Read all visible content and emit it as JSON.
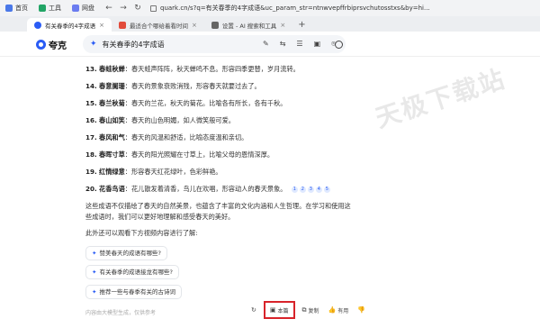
{
  "browser": {
    "apps": [
      {
        "label": "首页",
        "color": "#4a78e8"
      },
      {
        "label": "工具",
        "color": "#22a566"
      },
      {
        "label": "网盘",
        "color": "#6b7cf0"
      }
    ],
    "address": "quark.cn/s?q=有关春季的4字成语&uc_param_str=ntnwvepffrbiprsvchutosstxs&by=hi..."
  },
  "tabs": [
    {
      "label": "有关春季的4字成语",
      "close": "×"
    },
    {
      "label": "最适合个哪给着看时间",
      "close": "×"
    },
    {
      "label": "设置 - AI 搜索和工具",
      "close": "×"
    }
  ],
  "new_tab": "+",
  "header": {
    "logo": "夸克",
    "query": "有关春季的4字成语"
  },
  "watermark": "天极下载站",
  "items": [
    {
      "num": "13.",
      "term": "春蛙秋蝉",
      "text": "：春天蛙声阵阵，秋天蝉鸣不息。形容四季更替，岁月流转。"
    },
    {
      "num": "14.",
      "term": "春意阑珊",
      "text": "：春天的景象衰败消残，形容春天就要过去了。"
    },
    {
      "num": "15.",
      "term": "春兰秋菊",
      "text": "：春天的兰花，秋天的菊花。比喻各有所长，各有千秋。"
    },
    {
      "num": "16.",
      "term": "春山如笑",
      "text": "：春天的山色明媚，如人微笑般可爱。"
    },
    {
      "num": "17.",
      "term": "春风和气",
      "text": "：春天的风温和舒适，比喻态度温和亲切。"
    },
    {
      "num": "18.",
      "term": "春晖寸草",
      "text": "：春天的阳光照耀在寸草上，比喻父母的恩情深厚。"
    },
    {
      "num": "19.",
      "term": "红情绿意",
      "text": "：形容春天红花绿叶，色彩鲜艳。"
    },
    {
      "num": "20.",
      "term": "花香鸟语",
      "text": "：花儿散发着清香，鸟儿在欢唱，形容动人的春天景象。"
    }
  ],
  "refs": [
    "1",
    "2",
    "3",
    "4",
    "5"
  ],
  "summary_line1": "这些成语不仅描绘了春天的自然美景，也蕴含了丰富的文化内涵和人生哲理。在学习和使用这",
  "summary_line2": "些成语时，我们可以更好地理解和感受春天的美好。",
  "more_prompt": "此外还可以观看下方视频内容进行了解:",
  "suggestions": [
    "赞美春天的成语有哪些?",
    "有关春季的成语接龙有哪些?",
    "推荐一些与春季有关的古诗词"
  ],
  "footer_note": "内容由大模型生成，仅供参考",
  "actions": {
    "save": "本篇",
    "copy": "复制",
    "like": "有用"
  }
}
